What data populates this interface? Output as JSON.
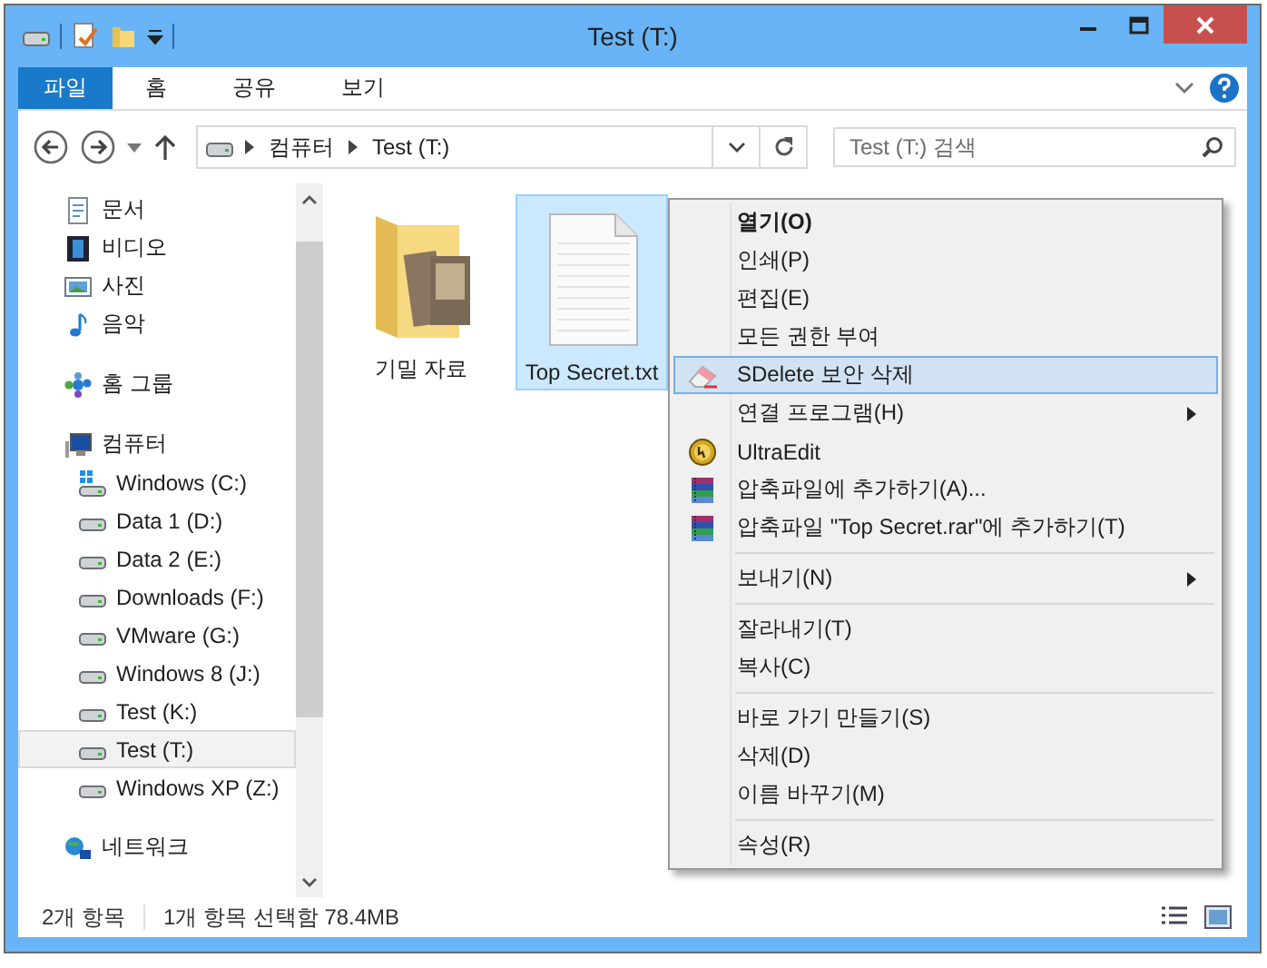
{
  "window": {
    "title": "Test (T:)"
  },
  "ribbon_tabs": [
    {
      "label": "파일",
      "kind": "file"
    },
    {
      "label": "홈",
      "kind": "tab"
    },
    {
      "label": "공유",
      "kind": "tab"
    },
    {
      "label": "보기",
      "kind": "tab"
    }
  ],
  "address_bar": {
    "path": [
      "컴퓨터",
      "Test (T:)"
    ]
  },
  "search": {
    "placeholder": "Test (T:) 검색"
  },
  "sidebar": {
    "sections": [
      {
        "items": [
          {
            "label": "문서",
            "kind": "document",
            "selected": false
          },
          {
            "label": "비디오",
            "kind": "video",
            "selected": false
          },
          {
            "label": "사진",
            "kind": "picture",
            "selected": false
          },
          {
            "label": "음악",
            "kind": "music",
            "selected": false
          }
        ]
      },
      {
        "items": [
          {
            "label": "홈 그룹",
            "kind": "homegroup",
            "selected": false
          }
        ]
      },
      {
        "items": [
          {
            "label": "컴퓨터",
            "kind": "computer",
            "selected": false,
            "children": [
              {
                "label": "Windows (C:)",
                "kind": "system-drive",
                "selected": false
              },
              {
                "label": "Data 1 (D:)",
                "kind": "drive",
                "selected": false
              },
              {
                "label": "Data 2 (E:)",
                "kind": "drive",
                "selected": false
              },
              {
                "label": "Downloads (F:)",
                "kind": "drive",
                "selected": false
              },
              {
                "label": "VMware (G:)",
                "kind": "drive",
                "selected": false
              },
              {
                "label": "Windows 8 (J:)",
                "kind": "drive",
                "selected": false
              },
              {
                "label": "Test (K:)",
                "kind": "drive",
                "selected": false
              },
              {
                "label": "Test (T:)",
                "kind": "drive",
                "selected": true
              },
              {
                "label": "Windows XP (Z:)",
                "kind": "drive",
                "selected": false
              }
            ]
          }
        ]
      },
      {
        "items": [
          {
            "label": "네트워크",
            "kind": "network",
            "selected": false
          }
        ]
      }
    ]
  },
  "files": [
    {
      "name": "기밀 자료",
      "kind": "folder",
      "selected": false
    },
    {
      "name": "Top Secret.txt",
      "kind": "text",
      "selected": true
    }
  ],
  "context_menu": [
    {
      "kind": "item",
      "label": "열기(O)",
      "bold": true,
      "selected": false
    },
    {
      "kind": "item",
      "label": "인쇄(P)",
      "selected": false
    },
    {
      "kind": "item",
      "label": "편집(E)",
      "selected": false
    },
    {
      "kind": "item",
      "label": "모든 권한 부여",
      "selected": false
    },
    {
      "kind": "eraser",
      "label": "SDelete 보안 삭제",
      "selected": true
    },
    {
      "kind": "item",
      "label": "연결 프로그램(H)",
      "submenu": true,
      "selected": false
    },
    {
      "kind": "ultraedit",
      "label": "UltraEdit",
      "selected": false
    },
    {
      "kind": "archive",
      "label": "압축파일에 추가하기(A)...",
      "selected": false
    },
    {
      "kind": "archive",
      "label": "압축파일 \"Top Secret.rar\"에 추가하기(T)",
      "selected": false
    },
    {
      "kind": "separator"
    },
    {
      "kind": "item",
      "label": "보내기(N)",
      "submenu": true,
      "selected": false
    },
    {
      "kind": "separator"
    },
    {
      "kind": "item",
      "label": "잘라내기(T)",
      "selected": false
    },
    {
      "kind": "item",
      "label": "복사(C)",
      "selected": false
    },
    {
      "kind": "separator"
    },
    {
      "kind": "item",
      "label": "바로 가기 만들기(S)",
      "selected": false
    },
    {
      "kind": "item",
      "label": "삭제(D)",
      "selected": false
    },
    {
      "kind": "item",
      "label": "이름 바꾸기(M)",
      "selected": false
    },
    {
      "kind": "separator"
    },
    {
      "kind": "item",
      "label": "속성(R)",
      "selected": false
    }
  ],
  "status_bar": {
    "item_count": "2개 항목",
    "selection": "1개 항목 선택함 78.4MB"
  }
}
